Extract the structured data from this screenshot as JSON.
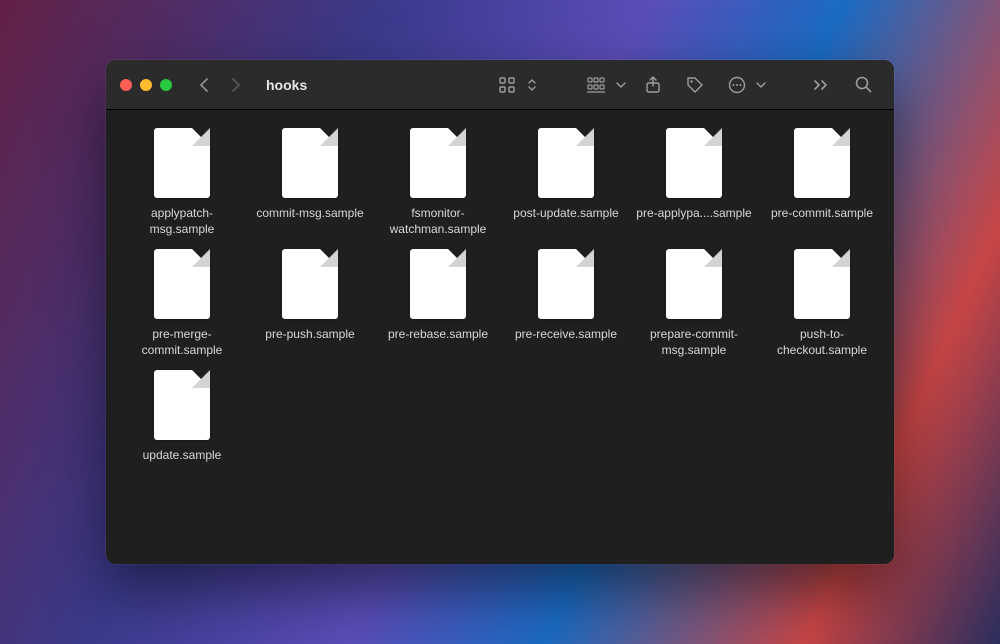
{
  "window": {
    "title": "hooks"
  },
  "files": [
    {
      "name": "applypatch-msg.sample"
    },
    {
      "name": "commit-msg.sample"
    },
    {
      "name": "fsmonitor-watchman.sample"
    },
    {
      "name": "post-update.sample"
    },
    {
      "name": "pre-applypa....sample"
    },
    {
      "name": "pre-commit.sample"
    },
    {
      "name": "pre-merge-commit.sample"
    },
    {
      "name": "pre-push.sample"
    },
    {
      "name": "pre-rebase.sample"
    },
    {
      "name": "pre-receive.sample"
    },
    {
      "name": "prepare-commit-msg.sample"
    },
    {
      "name": "push-to-checkout.sample"
    },
    {
      "name": "update.sample"
    }
  ]
}
